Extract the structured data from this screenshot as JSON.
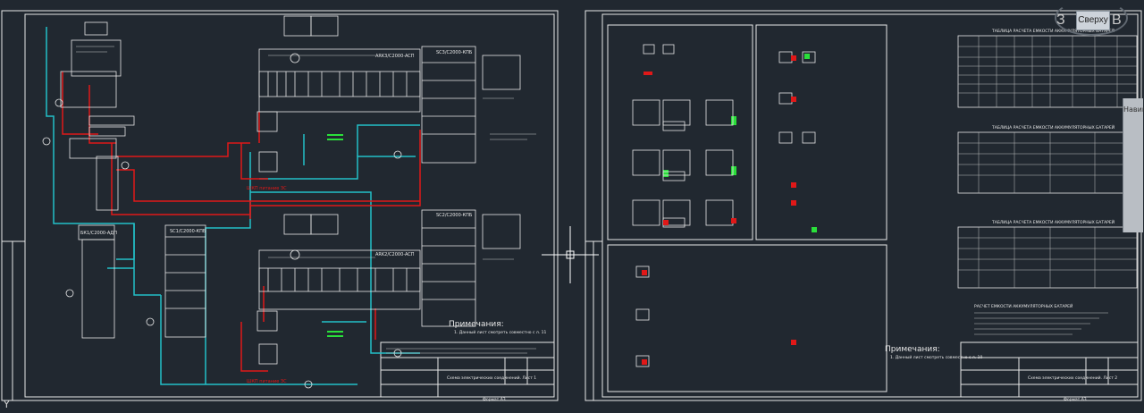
{
  "viewcube": {
    "face": "Сверху",
    "left": "З",
    "right": "В"
  },
  "ucs": {
    "label": "Y"
  },
  "sheet1": {
    "top_modules": [
      "ARK3/C2000-ACП",
      "ARK2/C2000-ACП"
    ],
    "right_modules": [
      "SC3/C2000-КПБ",
      "SC2/C2000-КПБ"
    ],
    "left_labels": [
      "ББП",
      "Бт",
      "ТЗК",
      "БК1/C2000-АДП",
      "SC1/C2000-КПБ"
    ],
    "notes_title": "Примечания:",
    "note_text": "1. Данный лист смотреть совместно с л. 11",
    "red_label_1": "ШКП питание ЗС",
    "red_label_2": "ШКП питание ЗС",
    "title_block": "Схема электрических соединений. Лист 1",
    "format": "Формат А3"
  },
  "sheet2": {
    "notes_title": "Примечания:",
    "note_text": "1. Данный лист смотреть совместно с л. 10",
    "table1_title": "ТАБЛИЦА РАСЧЕТА ЕМКОСТИ АККУМУЛЯТОРНЫХ БАТАРЕЙ",
    "table2_title": "ТАБЛИЦА РАСЧЕТА ЕМКОСТИ АККУМУЛЯТОРНЫХ БАТАРЕЙ",
    "table3_title": "ТАБЛИЦА РАСЧЕТА ЕМКОСТИ АККУМУЛЯТОРНЫХ БАТАРЕЙ",
    "calc_title": "РАСЧЕТ ЕМКОСТИ АККУМУЛЯТОРНЫХ БАТАРЕЙ",
    "title_block": "Схема электрических соединений. Лист 2",
    "format": "Формат А3"
  },
  "colors": {
    "background": "#212830",
    "frame": "#e8e8e8",
    "wire_red": "#e01818",
    "wire_cyan": "#22c0c8",
    "accent_green": "#2adf3a"
  },
  "navbar": {
    "label": "Навигация"
  }
}
